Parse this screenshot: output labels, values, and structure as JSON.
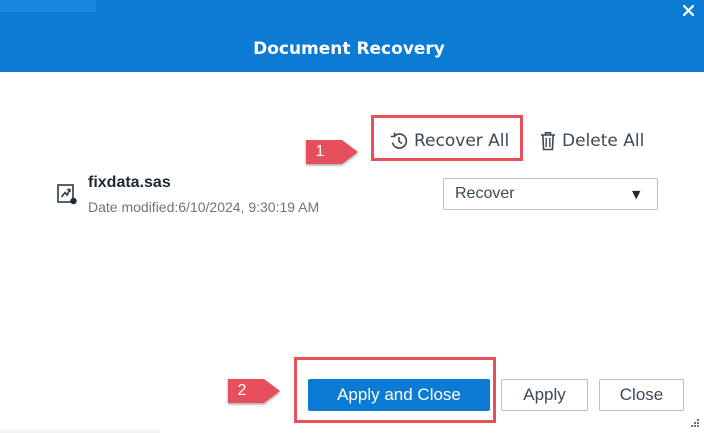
{
  "dialog": {
    "title": "Document Recovery",
    "close_icon": "close-icon"
  },
  "actions": {
    "recover_all_label": "Recover All",
    "recover_all_icon": "recover-icon",
    "delete_all_label": "Delete All",
    "delete_all_icon": "trash-icon"
  },
  "file": {
    "icon": "sas-program-file-icon",
    "name": "fixdata.sas",
    "date_modified": "Date modified:6/10/2024, 9:30:19 AM",
    "action_select_value": "Recover"
  },
  "footer": {
    "apply_and_close_label": "Apply and Close",
    "apply_label": "Apply",
    "close_label": "Close"
  },
  "annotations": {
    "callout_1": "1",
    "callout_2": "2"
  },
  "colors": {
    "header": "#0c7bd4",
    "primary_button": "#0c7bd4",
    "highlight": "#e8505b",
    "text": "#3b4a56"
  }
}
